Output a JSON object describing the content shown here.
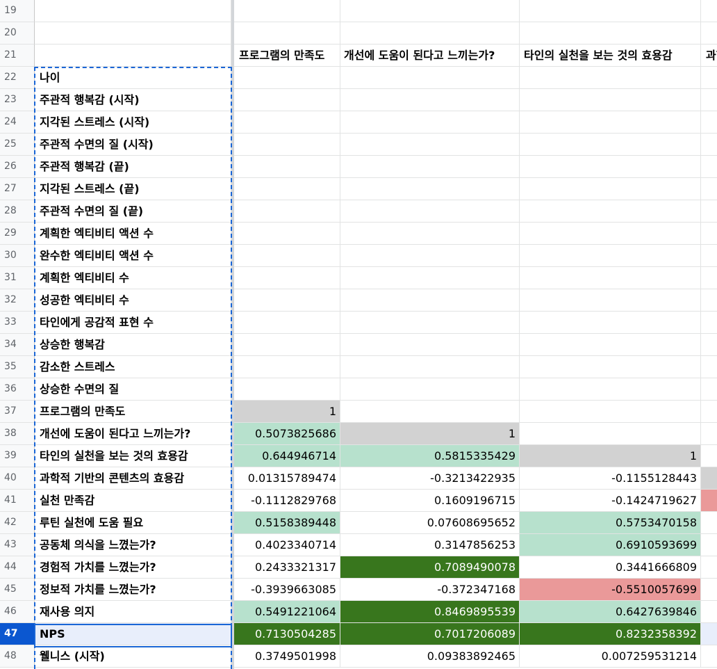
{
  "headers": {
    "col_b": "프로그램의 만족도",
    "col_c": "개선에 도움이 된다고 느끼는가?",
    "col_d": "타인의 실천을 보는 것의 효용감",
    "col_e": "과학"
  },
  "selected_row": "47",
  "rows": [
    {
      "num": "19",
      "label": "",
      "b": "",
      "c": "",
      "d": ""
    },
    {
      "num": "20",
      "label": "",
      "b": "",
      "c": "",
      "d": ""
    },
    {
      "num": "21",
      "label": "",
      "b": "",
      "c": "",
      "d": ""
    },
    {
      "num": "22",
      "label": "나이",
      "b": "",
      "c": "",
      "d": ""
    },
    {
      "num": "23",
      "label": "주관적 행복감 (시작)",
      "b": "",
      "c": "",
      "d": ""
    },
    {
      "num": "24",
      "label": "지각된 스트레스 (시작)",
      "b": "",
      "c": "",
      "d": ""
    },
    {
      "num": "25",
      "label": "주관적 수면의 질 (시작)",
      "b": "",
      "c": "",
      "d": ""
    },
    {
      "num": "26",
      "label": "주관적 행복감 (끝)",
      "b": "",
      "c": "",
      "d": ""
    },
    {
      "num": "27",
      "label": "지각된 스트레스 (끝)",
      "b": "",
      "c": "",
      "d": ""
    },
    {
      "num": "28",
      "label": "주관적 수면의 질 (끝)",
      "b": "",
      "c": "",
      "d": ""
    },
    {
      "num": "29",
      "label": "계획한 엑티비티 액션 수",
      "b": "",
      "c": "",
      "d": ""
    },
    {
      "num": "30",
      "label": "완수한 엑티비티 액션 수",
      "b": "",
      "c": "",
      "d": ""
    },
    {
      "num": "31",
      "label": "계획한 엑티비티 수",
      "b": "",
      "c": "",
      "d": ""
    },
    {
      "num": "32",
      "label": "성공한 엑티비티 수",
      "b": "",
      "c": "",
      "d": ""
    },
    {
      "num": "33",
      "label": "타인에게 공감적 표현 수",
      "b": "",
      "c": "",
      "d": ""
    },
    {
      "num": "34",
      "label": "상승한 행복감",
      "b": "",
      "c": "",
      "d": ""
    },
    {
      "num": "35",
      "label": "감소한 스트레스",
      "b": "",
      "c": "",
      "d": ""
    },
    {
      "num": "36",
      "label": "상승한 수면의 질",
      "b": "",
      "c": "",
      "d": ""
    },
    {
      "num": "37",
      "label": "프로그램의 만족도",
      "b": "1",
      "c": "",
      "d": ""
    },
    {
      "num": "38",
      "label": "개선에 도움이 된다고 느끼는가?",
      "b": "0.5073825686",
      "c": "1",
      "d": ""
    },
    {
      "num": "39",
      "label": "타인의 실천을 보는 것의 효용감",
      "b": "0.644946714",
      "c": "0.5815335429",
      "d": "1"
    },
    {
      "num": "40",
      "label": "과학적 기반의 콘텐츠의 효용감",
      "b": "0.01315789474",
      "c": "-0.3213422935",
      "d": "-0.1155128443"
    },
    {
      "num": "41",
      "label": "실천 만족감",
      "b": "-0.1112829768",
      "c": "0.1609196715",
      "d": "-0.1424719627"
    },
    {
      "num": "42",
      "label": "루틴 실천에 도움 필요",
      "b": "0.5158389448",
      "c": "0.07608695652",
      "d": "0.5753470158"
    },
    {
      "num": "43",
      "label": "공동체 의식을 느꼈는가?",
      "b": "0.4023340714",
      "c": "0.3147856253",
      "d": "0.6910593699"
    },
    {
      "num": "44",
      "label": "경험적 가치를 느꼈는가?",
      "b": "0.2433321317",
      "c": "0.7089490078",
      "d": "0.3441666809"
    },
    {
      "num": "45",
      "label": "정보적 가치를 느꼈는가?",
      "b": "-0.3939663085",
      "c": "-0.372347168",
      "d": "-0.5510057699"
    },
    {
      "num": "46",
      "label": "재사용 의지",
      "b": "0.5491221064",
      "c": "0.8469895539",
      "d": "0.6427639846"
    },
    {
      "num": "47",
      "label": "NPS",
      "b": "0.7130504285",
      "c": "0.7017206089",
      "d": "0.8232358392"
    },
    {
      "num": "48",
      "label": "웰니스 (시작)",
      "b": "0.3749501998",
      "c": "0.09383892465",
      "d": "0.007259531214"
    }
  ],
  "colors": {
    "grey": "#d2d2d2",
    "light_green": "#b7e1cd",
    "dark_green": "#38761d",
    "red": "#ea9999",
    "selection": "#1a66d6"
  }
}
